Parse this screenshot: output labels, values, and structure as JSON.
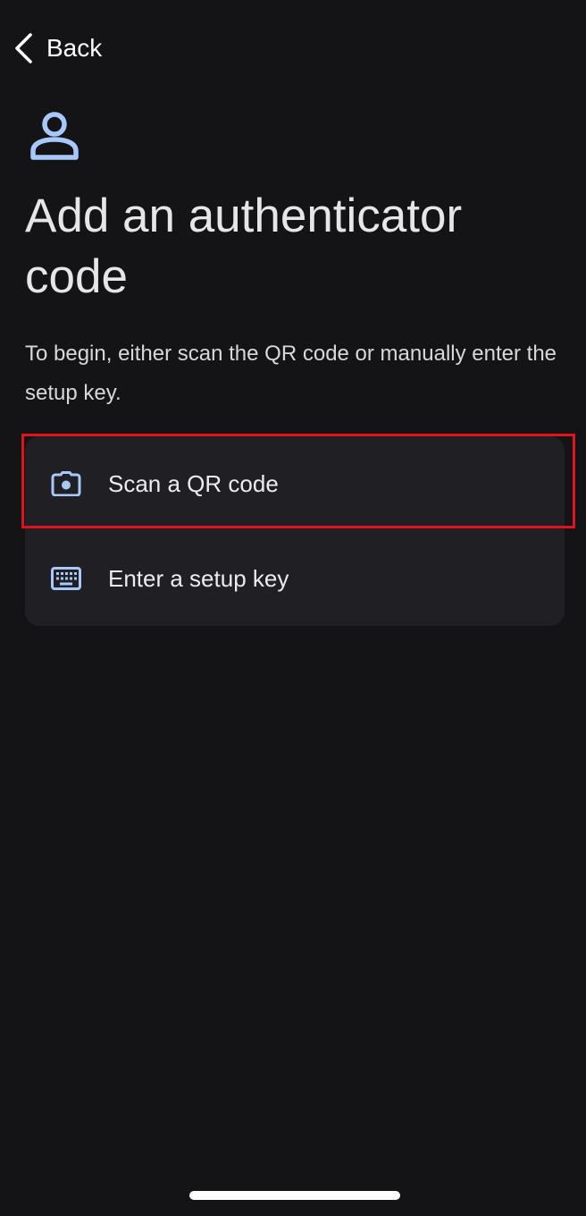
{
  "nav": {
    "back_label": "Back",
    "back_icon": "chevron-left-icon"
  },
  "header": {
    "icon": "person-icon",
    "title": "Add an authenticator code",
    "description": "To begin, either scan the QR code or manually enter the setup key."
  },
  "options": [
    {
      "label": "Scan a QR code",
      "icon": "camera-icon",
      "highlighted": true
    },
    {
      "label": "Enter a setup key",
      "icon": "keyboard-icon",
      "highlighted": false
    }
  ],
  "colors": {
    "background": "#141416",
    "card": "#202024",
    "icon_accent": "#a8c7fa",
    "highlight": "#e0121b",
    "text": "#e6e6e8"
  }
}
